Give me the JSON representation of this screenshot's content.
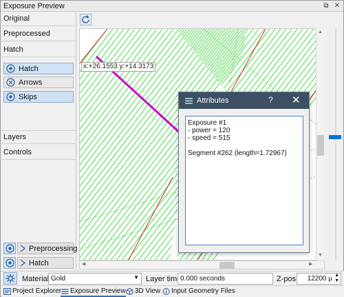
{
  "window": {
    "title": "Exposure Preview",
    "float_icon": "float-icon",
    "close_icon": "close-icon"
  },
  "left_panel": {
    "sections": {
      "original": "Original",
      "preprocessed": "Preprocessed",
      "hatch": "Hatch",
      "layers": "Layers",
      "controls": "Controls"
    },
    "hatch_toggles": [
      {
        "label": "Hatch",
        "icon": "eye-icon",
        "active": true
      },
      {
        "label": "Arrows",
        "icon": "circle-x-icon",
        "active": false
      },
      {
        "label": "Skips",
        "icon": "eye-icon",
        "active": true
      }
    ],
    "bottom_rows": [
      {
        "label": "Preprocessing",
        "icon": "eye-icon"
      },
      {
        "label": "Hatch",
        "icon": "eye-icon"
      }
    ]
  },
  "view": {
    "coord_readout": "x:+26.1553 y:+14.3173",
    "colors": {
      "hatch": "#33dd33",
      "skip": "#d000d0",
      "contour": "#cc1111",
      "grid": "#22bb22"
    }
  },
  "dialog": {
    "title": "Attributes",
    "help": "?",
    "lines": [
      "Exposure #1",
      "- power = 120",
      "- speed = 515",
      "",
      "Segment #262 (length=1.72967)"
    ]
  },
  "bottom": {
    "material_label": "Material",
    "material_value": "Gold",
    "layer_time_label": "Layer time",
    "layer_time_value": "0.000 seconds",
    "zpos_label": "Z-pos",
    "zpos_value": "12200 µ"
  },
  "tabs": [
    {
      "label": "Project Explorer",
      "icon": "project-explorer-icon",
      "active": false
    },
    {
      "label": "Exposure Preview",
      "icon": "exposure-preview-icon",
      "active": true
    },
    {
      "label": "3D View",
      "icon": "cube-icon",
      "active": false
    },
    {
      "label": "Input Geometry Files",
      "icon": "info-icon",
      "active": false
    }
  ]
}
